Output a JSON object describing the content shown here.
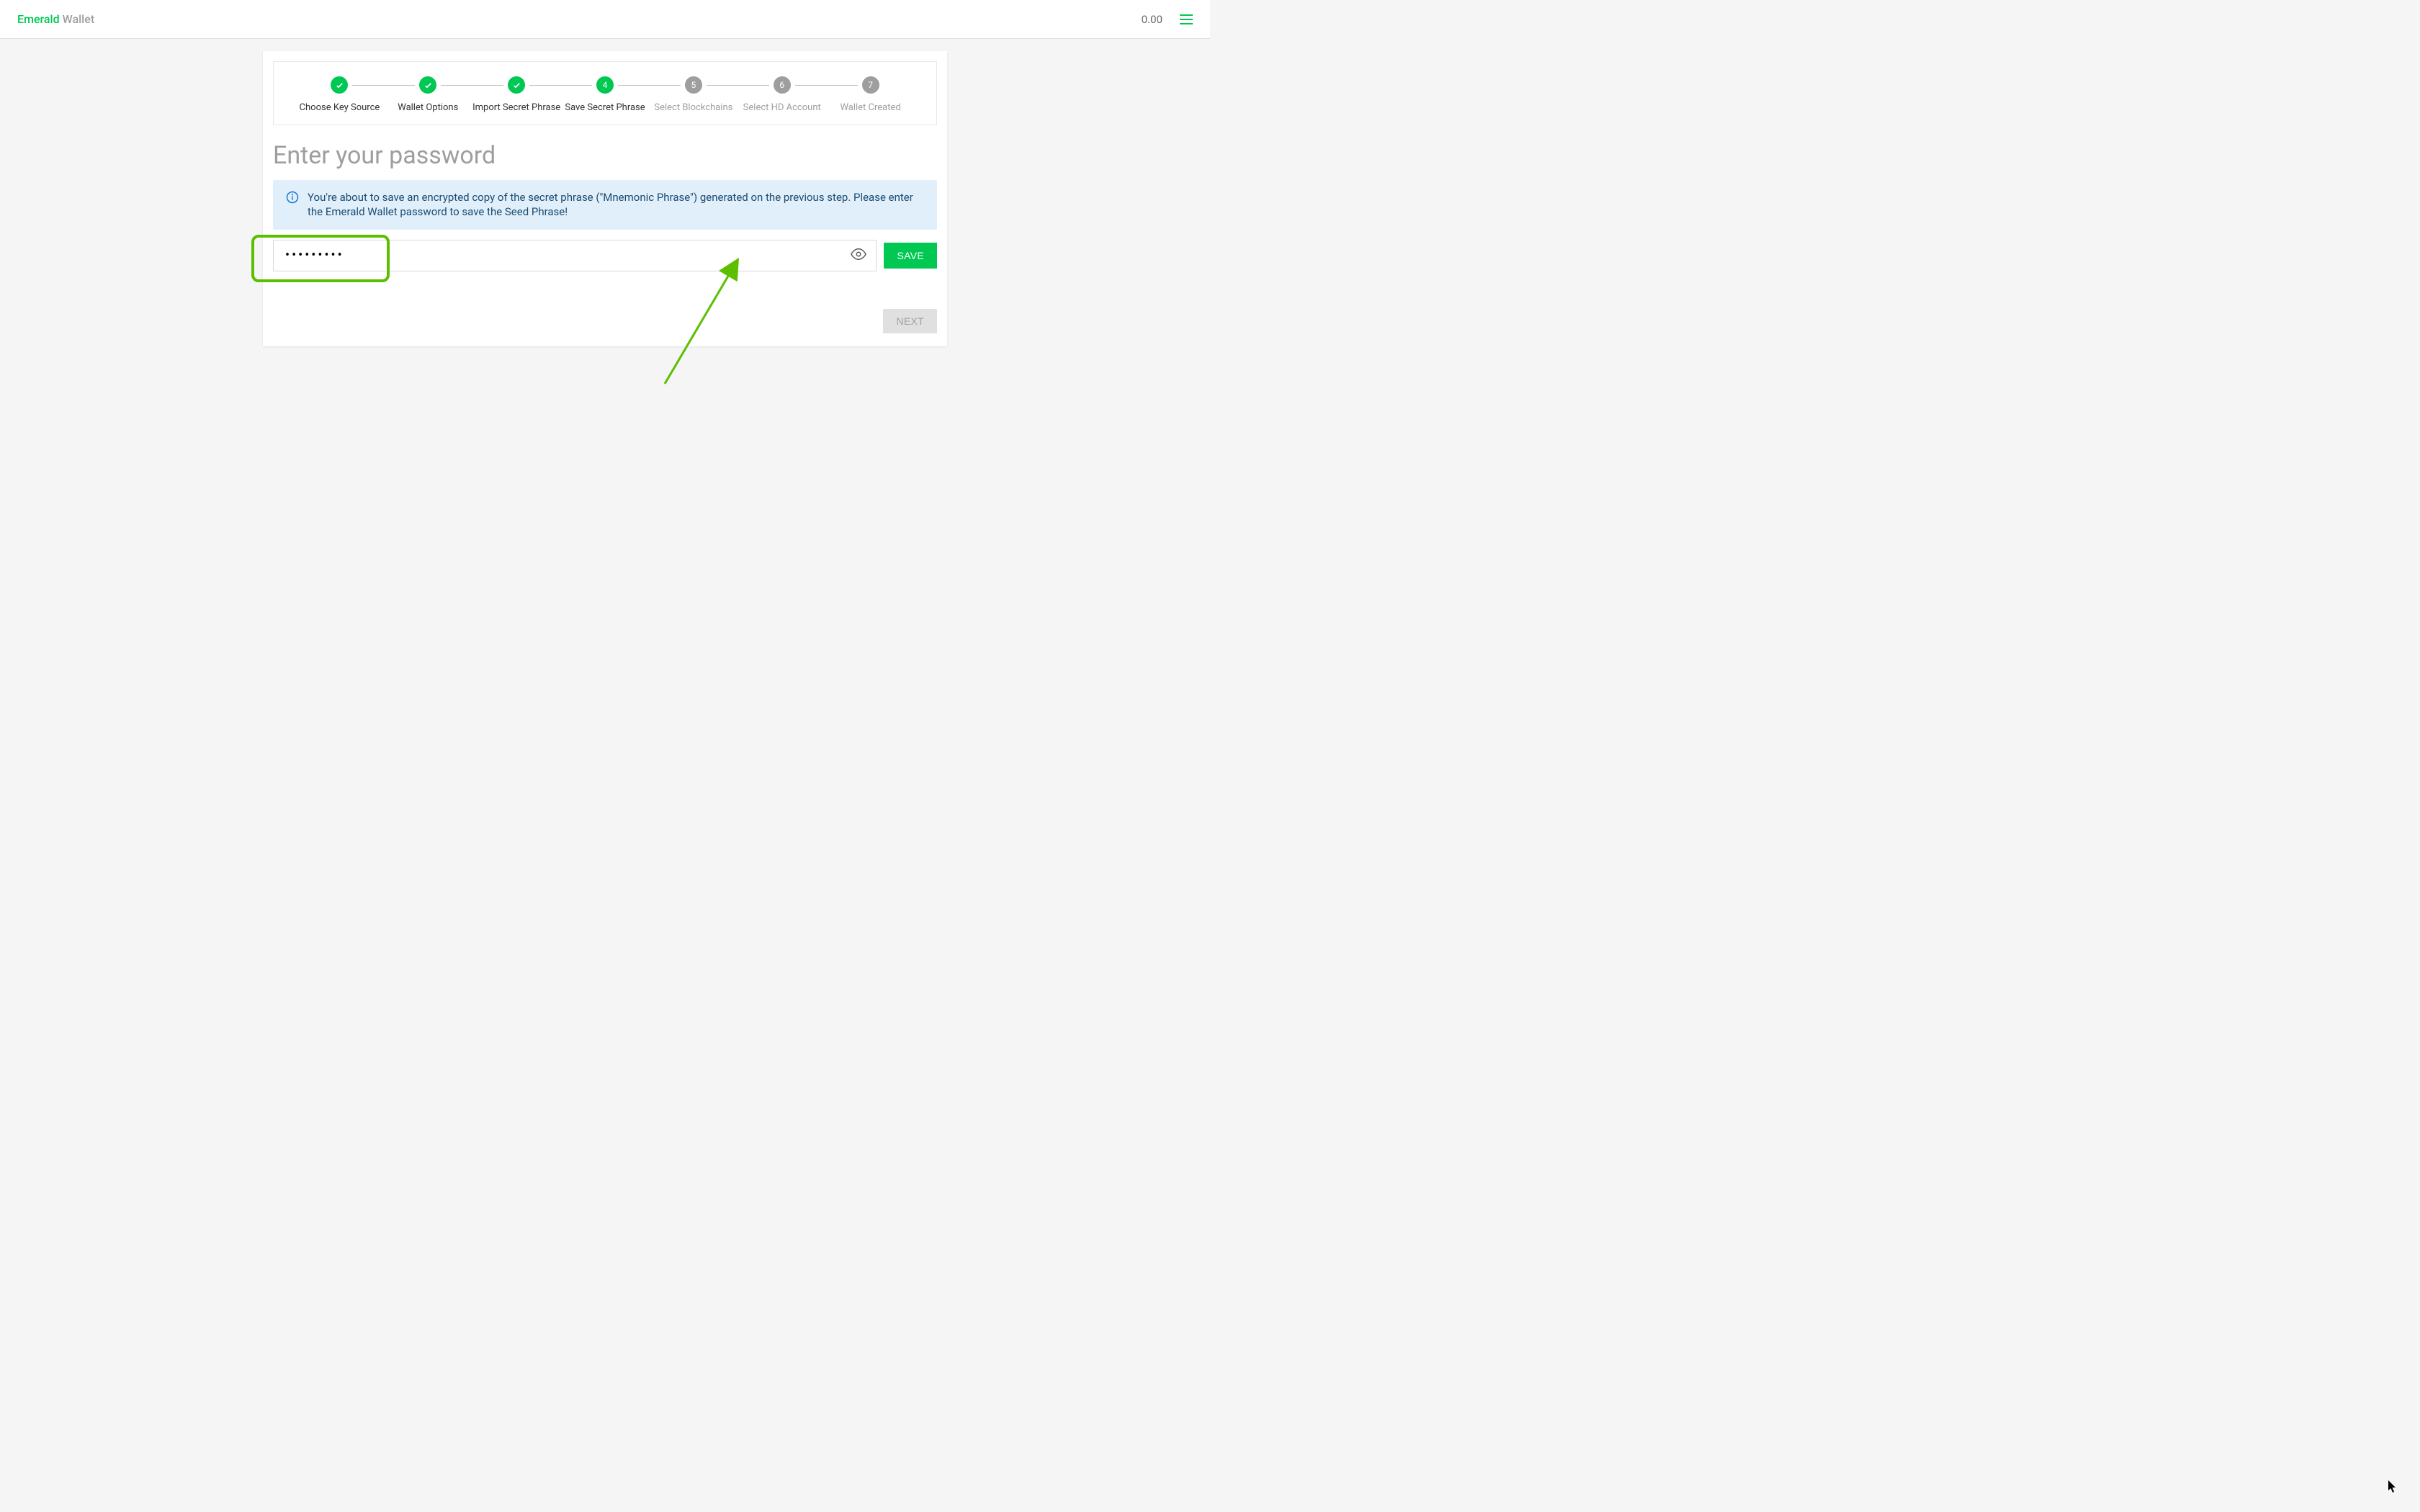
{
  "header": {
    "logo_brand": "Emerald",
    "logo_product": "Wallet",
    "balance": "0.00"
  },
  "stepper": {
    "steps": [
      {
        "label": "Choose Key Source",
        "state": "done"
      },
      {
        "label": "Wallet Options",
        "state": "done"
      },
      {
        "label": "Import Secret Phrase",
        "state": "done"
      },
      {
        "label": "Save Secret Phrase",
        "state": "active",
        "number": "4"
      },
      {
        "label": "Select Blockchains",
        "state": "pending",
        "number": "5"
      },
      {
        "label": "Select HD Account",
        "state": "pending",
        "number": "6"
      },
      {
        "label": "Wallet Created",
        "state": "pending",
        "number": "7"
      }
    ]
  },
  "page": {
    "title": "Enter your password",
    "info_text": "You're about to save an encrypted copy of the secret phrase (\"Mnemonic Phrase\") generated on the previous step. Please enter the Emerald Wallet password to save the Seed Phrase!",
    "password_value": "•••••••••",
    "save_label": "SAVE",
    "next_label": "NEXT"
  },
  "colors": {
    "accent": "#00c853",
    "annotation": "#5bbf00"
  }
}
